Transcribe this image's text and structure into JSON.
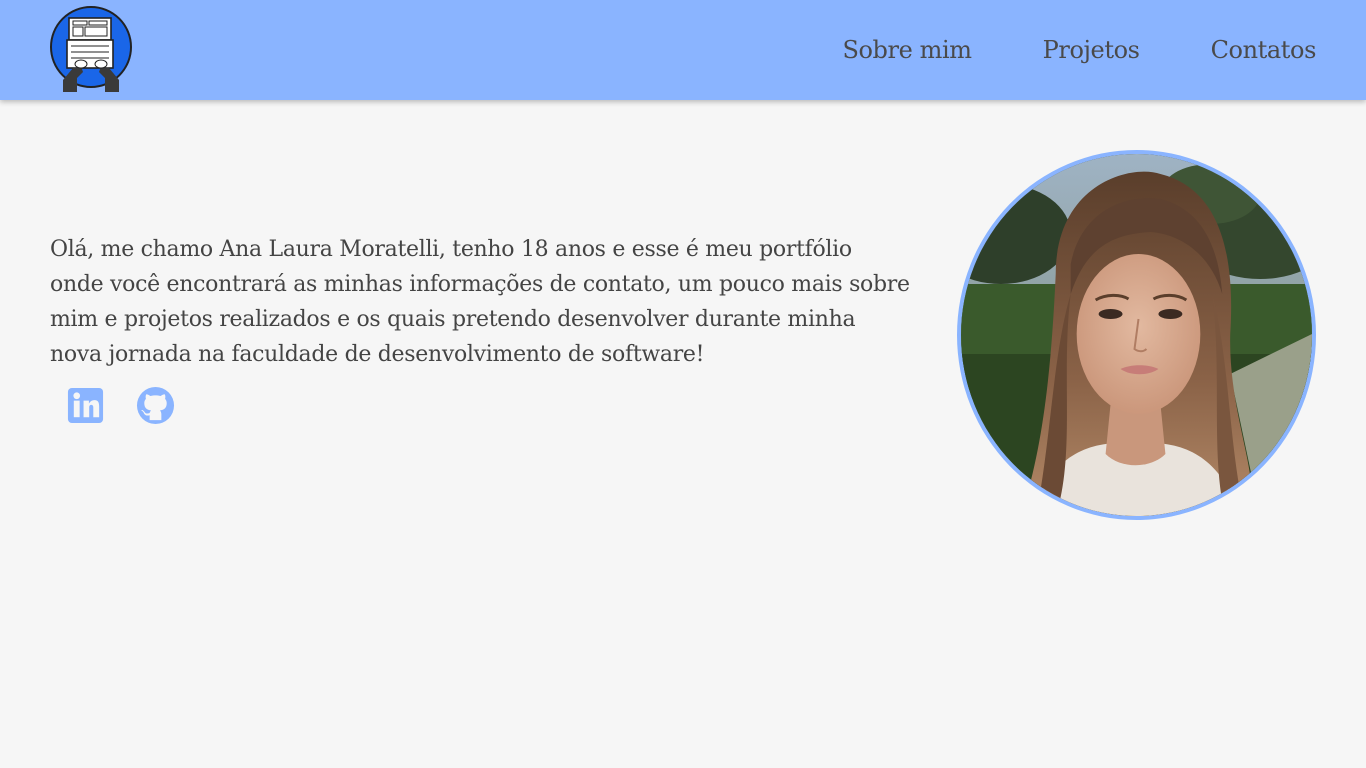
{
  "header": {
    "logo_icon": "typing-laptop-logo-icon",
    "nav": [
      {
        "label": "Sobre mim"
      },
      {
        "label": "Projetos"
      },
      {
        "label": "Contatos"
      }
    ]
  },
  "main": {
    "intro": "Olá, me chamo Ana Laura Moratelli, tenho 18 anos e esse é meu portfólio onde você encontrará as minhas informações de contato, um pouco mais sobre mim e projetos realizados e os quais pretendo desenvolver durante minha nova jornada na faculdade de desenvolvimento de software!",
    "socials": [
      {
        "icon": "linkedin-icon"
      },
      {
        "icon": "github-icon"
      }
    ],
    "profile_photo": "profile-photo"
  },
  "colors": {
    "header_bg": "#8ab4ff",
    "page_bg": "#f6f6f6",
    "accent": "#8ab4ff",
    "logo_blue": "#1a66e8",
    "text": "#444444"
  }
}
